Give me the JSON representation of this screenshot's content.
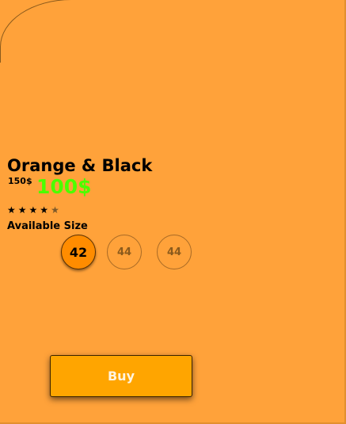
{
  "product": {
    "title": "Orange & Black",
    "old_price": "150$",
    "new_price": "100$",
    "rating": 4,
    "rating_max": 5,
    "stars": [
      "★",
      "★",
      "★",
      "★",
      "★"
    ]
  },
  "sizes": {
    "label": "Available Size",
    "options": [
      "42",
      "44",
      "44"
    ],
    "selected_index": 0
  },
  "actions": {
    "buy_label": "Buy"
  },
  "colors": {
    "background": "#ffa23a",
    "new_price": "#4cff00",
    "selected_size": "#ff8c00",
    "buy_button": "#ffa500"
  }
}
